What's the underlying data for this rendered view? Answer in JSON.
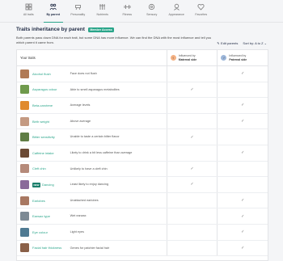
{
  "nav": [
    {
      "label": "All traits",
      "icon": "grid-icon"
    },
    {
      "label": "By parent",
      "icon": "family-icon",
      "active": true
    },
    {
      "label": "Personality",
      "icon": "personality-icon"
    },
    {
      "label": "Nutrients",
      "icon": "nutrients-icon"
    },
    {
      "label": "Fitness",
      "icon": "dumbbell-icon"
    },
    {
      "label": "Sensory",
      "icon": "sensory-icon"
    },
    {
      "label": "Appearance",
      "icon": "appearance-icon"
    },
    {
      "label": "Favorites",
      "icon": "heart-icon"
    }
  ],
  "header": {
    "title": "Traits inheritance by parent",
    "badge": "Member Access",
    "description": "Both parents pass down DNA for each trait, but some DNA has more influence. We can find the DNA with the most influence and tell you which parent it came from.",
    "edit_parents": "Edit parents",
    "sort_by": "Sort by: A to Z ⌄"
  },
  "table": {
    "col_traits": "Your traits",
    "maternal": {
      "line1": "Influenced by",
      "line2": "Maternal side"
    },
    "paternal": {
      "line1": "Influenced by",
      "line2": "Paternal side"
    },
    "new_label": "NEW",
    "check": "✓",
    "rows": [
      {
        "name": "Alcohol flush",
        "result": "Face does not flush",
        "maternal": false,
        "paternal": true,
        "color": "#b07a55"
      },
      {
        "name": "Asparagus odour",
        "result": "Able to smell asparagus metabolites",
        "maternal": true,
        "paternal": false,
        "color": "#6f9a4c"
      },
      {
        "name": "Beta-carotene",
        "result": "Average levels",
        "maternal": false,
        "paternal": true,
        "color": "#e08a2e"
      },
      {
        "name": "Birth weight",
        "result": "Above average",
        "maternal": false,
        "paternal": true,
        "color": "#c49a82"
      },
      {
        "name": "Bitter sensitivity",
        "result": "Unable to taste a certain bitter flavor",
        "maternal": true,
        "paternal": false,
        "color": "#5f7d44"
      },
      {
        "name": "Caffeine intake",
        "result": "Likely to drink a bit less caffeine than average",
        "maternal": false,
        "paternal": true,
        "color": "#6b4a34"
      },
      {
        "name": "Cleft chin",
        "result": "Unlikely to have a cleft chin",
        "maternal": true,
        "paternal": false,
        "color": "#b58a7a"
      },
      {
        "name": "Dancing",
        "result": "Least likely to enjoy dancing",
        "maternal": true,
        "paternal": false,
        "color": "#8a6a9a",
        "is_new": true
      },
      {
        "name": "Earlobes",
        "result": "Unattached earlobes",
        "maternal": false,
        "paternal": true,
        "color": "#a87862"
      },
      {
        "name": "Earwax type",
        "result": "Wet earwax",
        "maternal": false,
        "paternal": true,
        "color": "#7d8a94"
      },
      {
        "name": "Eye colour",
        "result": "Light eyes",
        "maternal": false,
        "paternal": true,
        "color": "#4f7a92"
      },
      {
        "name": "Facial hair thickness",
        "result": "Genes for patchier facial hair",
        "maternal": false,
        "paternal": true,
        "color": "#8a6048"
      }
    ]
  }
}
